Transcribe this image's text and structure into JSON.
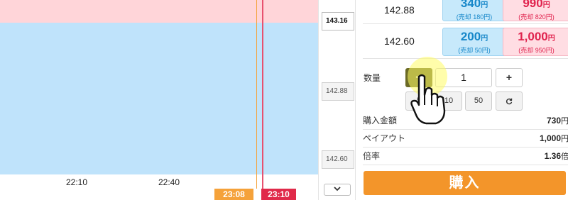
{
  "chart": {
    "x_ticks": [
      "22:10",
      "22:40"
    ],
    "time_flags": {
      "entry": "23:08",
      "expiry": "23:10"
    },
    "colors": {
      "upper_zone": "#ffd5d9",
      "lower_zone": "#bfe3fb",
      "entry_line": "#f5a23a",
      "expiry_line": "#e8516f"
    }
  },
  "axis": {
    "current_price": "143.16",
    "prices": [
      "142.88",
      "142.60"
    ],
    "scroll_icon": "chevron-down-icon"
  },
  "rows": [
    {
      "strike": "142.88",
      "up_price": "340",
      "up_unit": "円",
      "up_sell": "(売却 180円)",
      "down_price": "990",
      "down_unit": "円",
      "down_sell": "(売却 820円)"
    },
    {
      "strike": "142.60",
      "up_price": "200",
      "up_unit": "円",
      "up_sell": "(売却 50円)",
      "down_price": "1,000",
      "down_unit": "円",
      "down_sell": "(売却 950円)"
    }
  ],
  "quantity": {
    "label": "数量",
    "minus": "−",
    "value": "1",
    "plus": "+",
    "presets": [
      "5",
      "10",
      "50"
    ],
    "reset_icon": "refresh-icon"
  },
  "summary": {
    "purchase_label": "購入金額",
    "purchase_value": "730",
    "purchase_unit": "円",
    "payout_label": "ペイアウト",
    "payout_value": "1,000",
    "payout_unit": "円",
    "ratio_label": "倍率",
    "ratio_value": "1.36",
    "ratio_unit": "倍"
  },
  "buy_button": "購入"
}
